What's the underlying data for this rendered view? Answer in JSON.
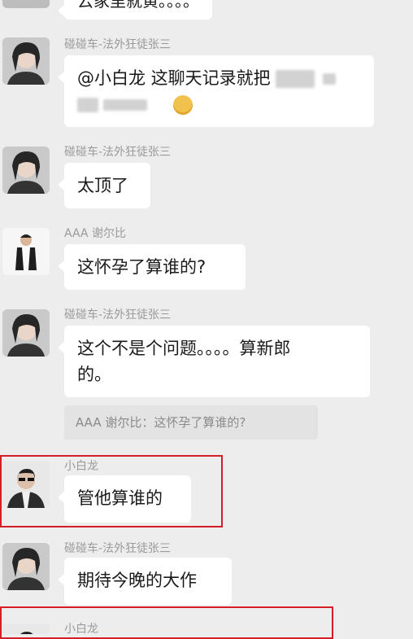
{
  "top_fragment": {
    "text": "云家里就黄。。。。"
  },
  "messages": [
    {
      "sender": "碰碰车-法外狂徒张三",
      "line1": "@小白龙 这聊天记录就把"
    },
    {
      "sender": "碰碰车-法外狂徒张三",
      "text": "太顶了"
    },
    {
      "sender": "AAA 谢尔比",
      "text": "这怀孕了算谁的?"
    },
    {
      "sender": "碰碰车-法外狂徒张三",
      "line1": "这个不是个问题。。。。算新郎",
      "line2": "的。",
      "quote": "AAA 谢尔比：这怀孕了算谁的?"
    },
    {
      "sender": "小白龙",
      "text": "管他算谁的"
    },
    {
      "sender": "碰碰车-法外狂徒张三",
      "text": "期待今晚的大作"
    },
    {
      "sender": "小白龙"
    }
  ],
  "colors": {
    "background": "#ededed",
    "bubble": "#ffffff",
    "highlight": "#d41f28"
  }
}
